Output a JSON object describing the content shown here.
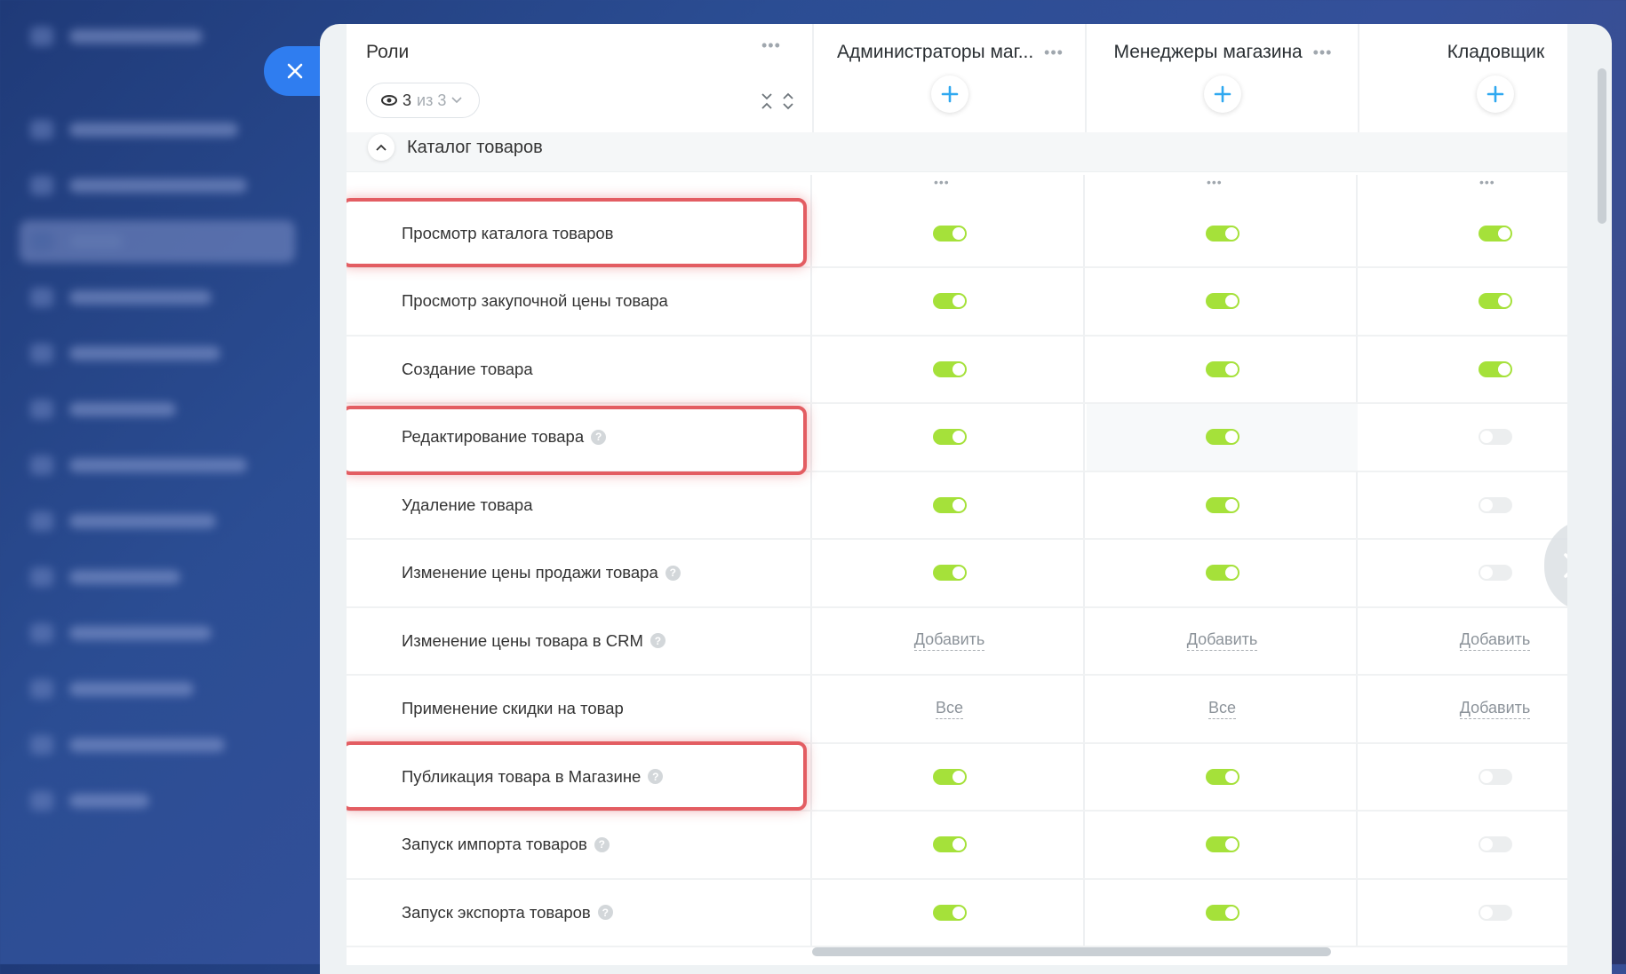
{
  "panel": {
    "roles_title": "Роли",
    "filter_count": "3",
    "filter_of": "из 3",
    "section": "Каталог товаров"
  },
  "columns": [
    {
      "name": "Администраторы маг..."
    },
    {
      "name": "Менеджеры магазина"
    },
    {
      "name": "Кладовщик"
    }
  ],
  "rows": [
    {
      "label": "Просмотр каталога товаров",
      "help": false,
      "values": [
        "on",
        "on",
        "on"
      ]
    },
    {
      "label": "Просмотр закупочной цены товара",
      "help": false,
      "values": [
        "on",
        "on",
        "on"
      ]
    },
    {
      "label": "Создание товара",
      "help": false,
      "values": [
        "on",
        "on",
        "on"
      ]
    },
    {
      "label": "Редактирование товара",
      "help": true,
      "values": [
        "on",
        "on",
        "off"
      ]
    },
    {
      "label": "Удаление товара",
      "help": false,
      "values": [
        "on",
        "on",
        "off"
      ]
    },
    {
      "label": "Изменение цены продажи товара",
      "help": true,
      "values": [
        "on",
        "on",
        "off"
      ]
    },
    {
      "label": "Изменение цены товара в CRM",
      "help": true,
      "values": [
        "Добавить",
        "Добавить",
        "Добавить"
      ]
    },
    {
      "label": "Применение скидки на товар",
      "help": false,
      "values": [
        "Все",
        "Все",
        "Добавить"
      ]
    },
    {
      "label": "Публикация товара в Магазине",
      "help": true,
      "values": [
        "on",
        "on",
        "off"
      ]
    },
    {
      "label": "Запуск импорта товаров",
      "help": true,
      "values": [
        "on",
        "on",
        "off"
      ]
    },
    {
      "label": "Запуск экспорта товаров",
      "help": true,
      "values": [
        "on",
        "on",
        "off"
      ]
    }
  ],
  "colors": {
    "toggle_on": "#a5e13a",
    "toggle_off": "#eceeef",
    "accent": "#2fa8f0",
    "highlight": "#e35d62"
  }
}
